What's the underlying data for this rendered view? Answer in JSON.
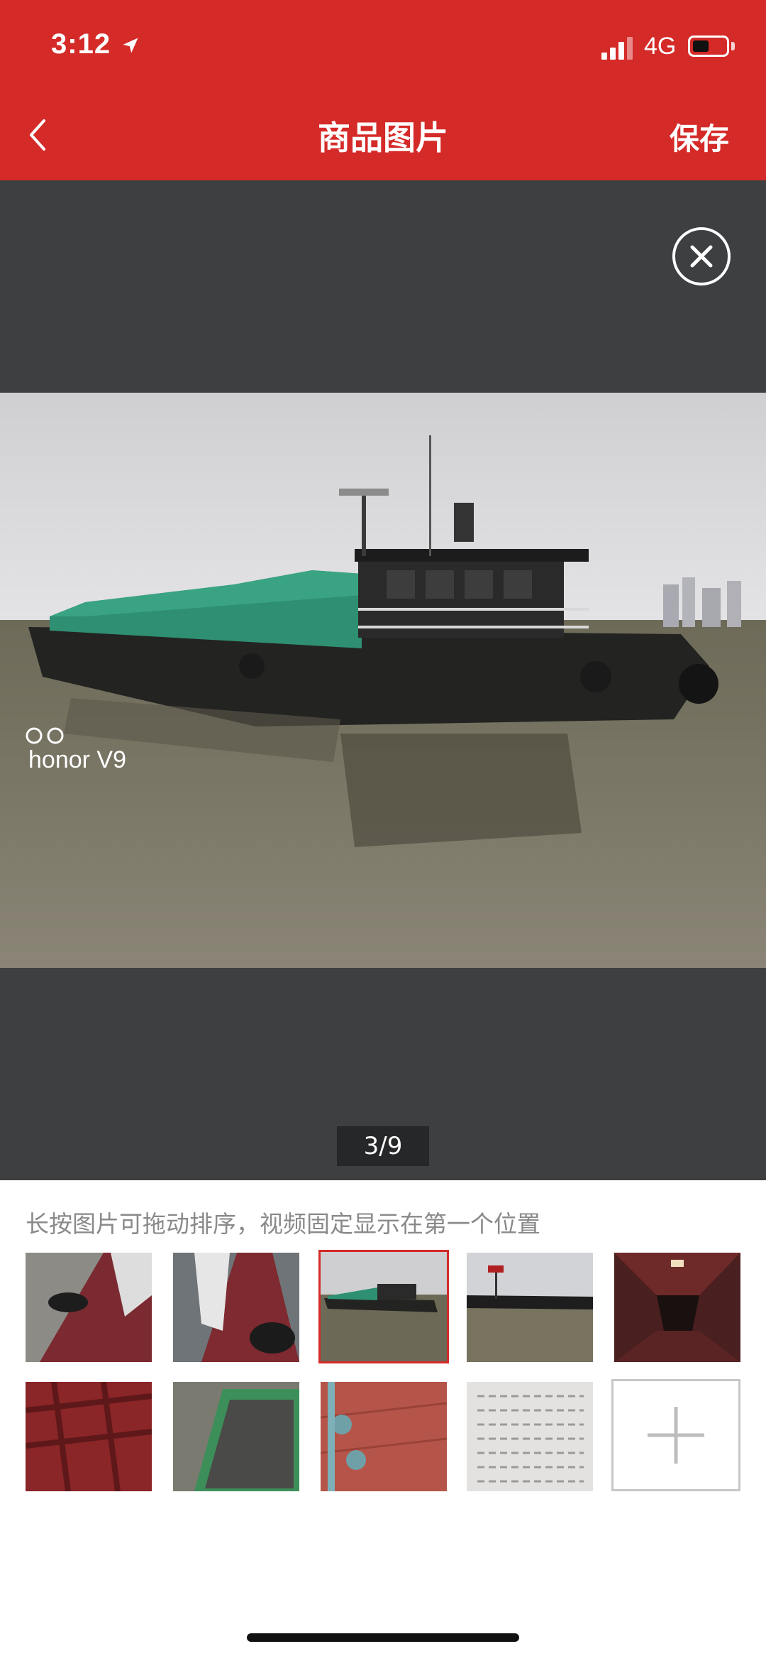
{
  "status_bar": {
    "time": "3:12",
    "network": "4G"
  },
  "header": {
    "title": "商品图片",
    "save_label": "保存"
  },
  "viewer": {
    "counter": "3/9",
    "watermark": "honor V9"
  },
  "hint": "长按图片可拖动排序，视频固定显示在第一个位置",
  "thumbnails": [
    {
      "label": "deck-bow"
    },
    {
      "label": "deck-tire"
    },
    {
      "label": "barge-tarp",
      "selected": true
    },
    {
      "label": "barge-flag"
    },
    {
      "label": "hold-interior"
    },
    {
      "label": "hull-frame"
    },
    {
      "label": "cargo-hold"
    },
    {
      "label": "deck-valves"
    },
    {
      "label": "document"
    }
  ],
  "colors": {
    "accent": "#d42a28",
    "viewer_bg": "#3e3f41"
  }
}
